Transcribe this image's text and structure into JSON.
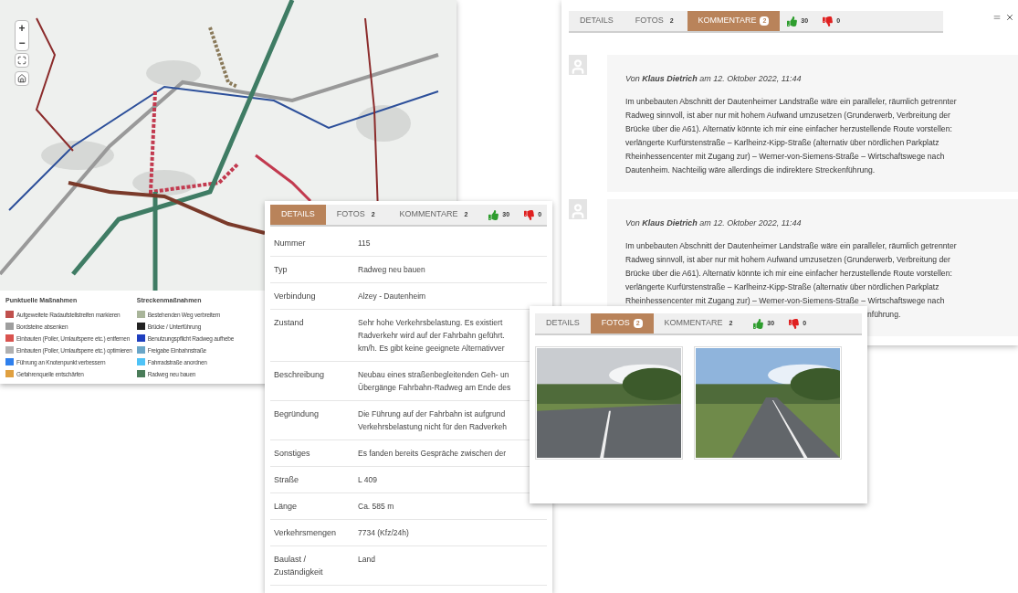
{
  "map_window": {
    "zoom_controls": [
      "+",
      "−"
    ],
    "legend": [
      {
        "title": "Punktuelle Maßnahmen",
        "items": [
          {
            "label": "Aufgeweitete Radaufstellstreifen markieren",
            "color": "#c0504d"
          },
          {
            "label": "Bordsteine absenken",
            "color": "#9e9e9e"
          },
          {
            "label": "Einbauten (Poller, Umlaufsperre etc.) entfernen",
            "color": "#d9534f"
          },
          {
            "label": "Einbauten (Poller, Umlaufsperre etc.) optimieren",
            "color": "#b0b0b0"
          },
          {
            "label": "Führung an Knotenpunkt verbessern",
            "color": "#2f80ed"
          },
          {
            "label": "Gefahrenquelle entschärfen",
            "color": "#e0a040"
          }
        ]
      },
      {
        "title": "Streckenmaßnahmen",
        "items": [
          {
            "label": "Bestehenden Weg verbreitern",
            "color": "#a9b59a"
          },
          {
            "label": "Brücke / Unterführung",
            "color": "#222222"
          },
          {
            "label": "Benutzungspflicht Radweg aufhebe",
            "color": "#1f3fbf"
          },
          {
            "label": "Freigabe Einbahnstraße",
            "color": "#6aa6c8"
          },
          {
            "label": "Fahrradstraße anordnen",
            "color": "#4fc3f7"
          },
          {
            "label": "Radweg neu bauen",
            "color": "#4a7c59"
          }
        ]
      }
    ]
  },
  "comments_window": {
    "tabs": [
      {
        "label": "DETAILS",
        "selected": false
      },
      {
        "label": "FOTOS",
        "badge": "2",
        "selected": false
      },
      {
        "label": "KOMMENTARE",
        "badge": "2",
        "selected": true
      }
    ],
    "votes": {
      "up": "30",
      "down": "0"
    },
    "comments": [
      {
        "header": "Von **Klaus Dietrich** am 12. Oktober 2022, 11:44",
        "lines": [
          "Im unbebauten Abschnitt der Dautenheimer Landstraße wäre ein paralleler, räumlich getrennter",
          "Radweg sinnvoll, ist aber nur mit hohem Aufwand umzusetzen (Grunderwerb, Verbreitung der",
          "Brücke über die A61). Alternativ könnte ich mir eine einfacher herzustellende Route vorstellen:",
          "verlängerte Kurfürstenstraße – Karlheinz-Kipp-Straße (alternativ über nördlichen Parkplatz",
          "Rheinhessencenter mit Zugang zur) – Werner-von-Siemens-Straße – Wirtschaftswege nach",
          "Dautenheim. Nachteilig wäre allerdings die indirektere Streckenführung."
        ]
      },
      {
        "header": "Von **Klaus Dietrich** am 12. Oktober 2022, 11:44",
        "lines": [
          "Im unbebauten Abschnitt der Dautenheimer Landstraße wäre ein paralleler, räumlich getrennter",
          "Radweg sinnvoll, ist aber nur mit hohem Aufwand umzusetzen (Grunderwerb, Verbreitung der",
          "Brücke über die A61). Alternativ könnte ich mir eine einfacher herzustellende Route vorstellen:",
          "verlängerte Kurfürstenstraße – Karlheinz-Kipp-Straße (alternativ über nördlichen Parkplatz",
          "Rheinhessencenter mit Zugang zur) – Werner-von-Siemens-Straße – Wirtschaftswege nach"
        ],
        "tail": "nführung."
      }
    ]
  },
  "details_window": {
    "tabs": [
      {
        "label": "DETAILS",
        "selected": true
      },
      {
        "label": "FOTOS",
        "badge": "2",
        "selected": false
      },
      {
        "label": "KOMMENTARE",
        "badge": "2",
        "selected": false
      }
    ],
    "votes": {
      "up": "30",
      "down": "0"
    },
    "rows": [
      {
        "label": "Nummer",
        "value": [
          "115"
        ]
      },
      {
        "label": "Typ",
        "value": [
          "Radweg neu bauen"
        ]
      },
      {
        "label": "Verbindung",
        "value": [
          "Alzey - Dautenheim"
        ]
      },
      {
        "label": "Zustand",
        "value": [
          "Sehr hohe Verkehrsbelastung. Es existiert",
          "Radverkehr wird auf der Fahrbahn geführt.",
          "km/h. Es gibt keine geeignete Alternativver"
        ]
      },
      {
        "label": "Beschreibung",
        "value": [
          "Neubau eines straßenbegleitenden Geh- un",
          "Übergänge Fahrbahn-Radweg am Ende des"
        ]
      },
      {
        "label": "Begründung",
        "value": [
          "Die Führung auf der Fahrbahn ist aufgrund",
          "Verkehrsbelastung nicht für den Radverkeh"
        ]
      },
      {
        "label": "Sonstiges",
        "value": [
          "Es fanden bereits Gespräche zwischen der"
        ]
      },
      {
        "label": "Straße",
        "value": [
          "L 409"
        ]
      },
      {
        "label": "Länge",
        "value": [
          "Ca. 585 m"
        ]
      },
      {
        "label": "Verkehrsmengen",
        "value": [
          "7734 (Kfz/24h)"
        ]
      },
      {
        "label": "Baulast / Zuständigkeit",
        "value": [
          "Land"
        ]
      }
    ]
  },
  "photos_window": {
    "tabs": [
      {
        "label": "DETAILS",
        "selected": false
      },
      {
        "label": "FOTOS",
        "badge": "2",
        "selected": true
      },
      {
        "label": "KOMMENTARE",
        "badge": "2",
        "selected": false
      }
    ],
    "votes": {
      "up": "30",
      "down": "0"
    }
  }
}
